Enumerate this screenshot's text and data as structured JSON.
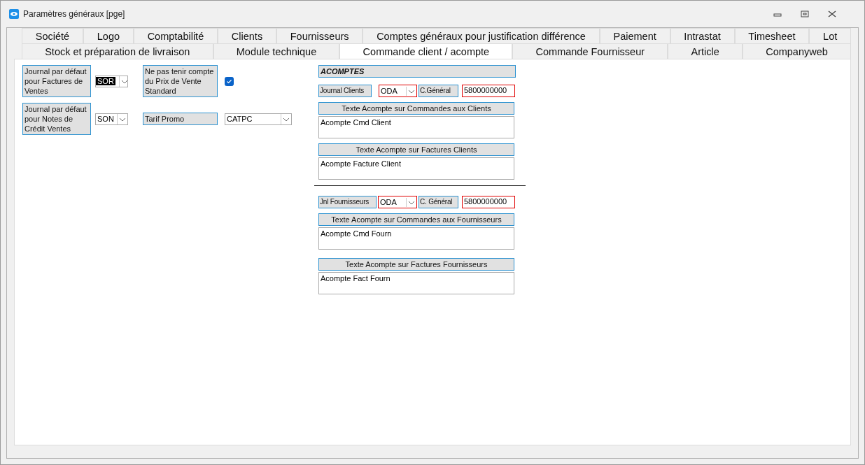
{
  "window": {
    "title": "Paramètres généraux [pge]"
  },
  "tab_rows": [
    {
      "tabs": [
        {
          "label": "Société",
          "selected": false
        },
        {
          "label": "Logo",
          "selected": false
        },
        {
          "label": "Comptabilité",
          "selected": false
        },
        {
          "label": "Clients",
          "selected": false
        },
        {
          "label": "Fournisseurs",
          "selected": false
        },
        {
          "label": "Comptes généraux pour justification différence",
          "selected": false
        },
        {
          "label": "Paiement",
          "selected": false
        },
        {
          "label": "Intrastat",
          "selected": false
        },
        {
          "label": "Timesheet",
          "selected": false
        },
        {
          "label": "Lot",
          "selected": false
        }
      ]
    },
    {
      "tabs": [
        {
          "label": "Stock et préparation de livraison",
          "selected": false
        },
        {
          "label": "Module technique",
          "selected": false
        },
        {
          "label": "Commande client / acompte",
          "selected": true
        },
        {
          "label": "Commande Fournisseur",
          "selected": false
        },
        {
          "label": "Article",
          "selected": false
        },
        {
          "label": "Companyweb",
          "selected": false
        }
      ]
    }
  ],
  "left_rows": [
    {
      "items": [
        {
          "kind": "label",
          "text": "Journal par défaut pour Factures de Ventes"
        },
        {
          "kind": "combo",
          "value": "SOR",
          "value_selected": true
        },
        {
          "kind": "label",
          "text": "Ne pas tenir compte du Prix de Vente Standard"
        },
        {
          "kind": "checkbox",
          "checked": true
        }
      ]
    },
    {
      "items": [
        {
          "kind": "label",
          "text": "Journal par défaut pour Notes de Crédit Ventes"
        },
        {
          "kind": "combo",
          "value": "SON",
          "value_selected": false
        },
        {
          "kind": "label",
          "text": "Tarif Promo"
        },
        {
          "kind": "combo",
          "value": "CATPC",
          "value_selected": false
        }
      ]
    }
  ],
  "acomptes": {
    "title": "ACOMPTES",
    "groups": [
      {
        "journal_label": "Journal Clients",
        "journal_value": "ODA",
        "journal_flagged": true,
        "account_label": "C.Général",
        "account_value": "5800000000",
        "account_flagged": true,
        "texts": [
          {
            "heading": "Texte Acompte sur Commandes aux Clients",
            "value": "Acompte Cmd Client"
          },
          {
            "heading": "Texte Acompte sur Factures Clients",
            "value": "Acompte Facture Client"
          }
        ]
      },
      {
        "journal_label": "Jnl Fournisseurs",
        "journal_value": "ODA",
        "journal_flagged": true,
        "account_label": "C. Général",
        "account_value": "5800000000",
        "account_flagged": true,
        "texts": [
          {
            "heading": "Texte Acompte sur Commandes aux Fournisseurs",
            "value": "Acompte Cmd Fourn"
          },
          {
            "heading": "Texte Acompte sur Factures Fournisseurs",
            "value": "Acompte Fact Fourn"
          }
        ]
      }
    ]
  }
}
